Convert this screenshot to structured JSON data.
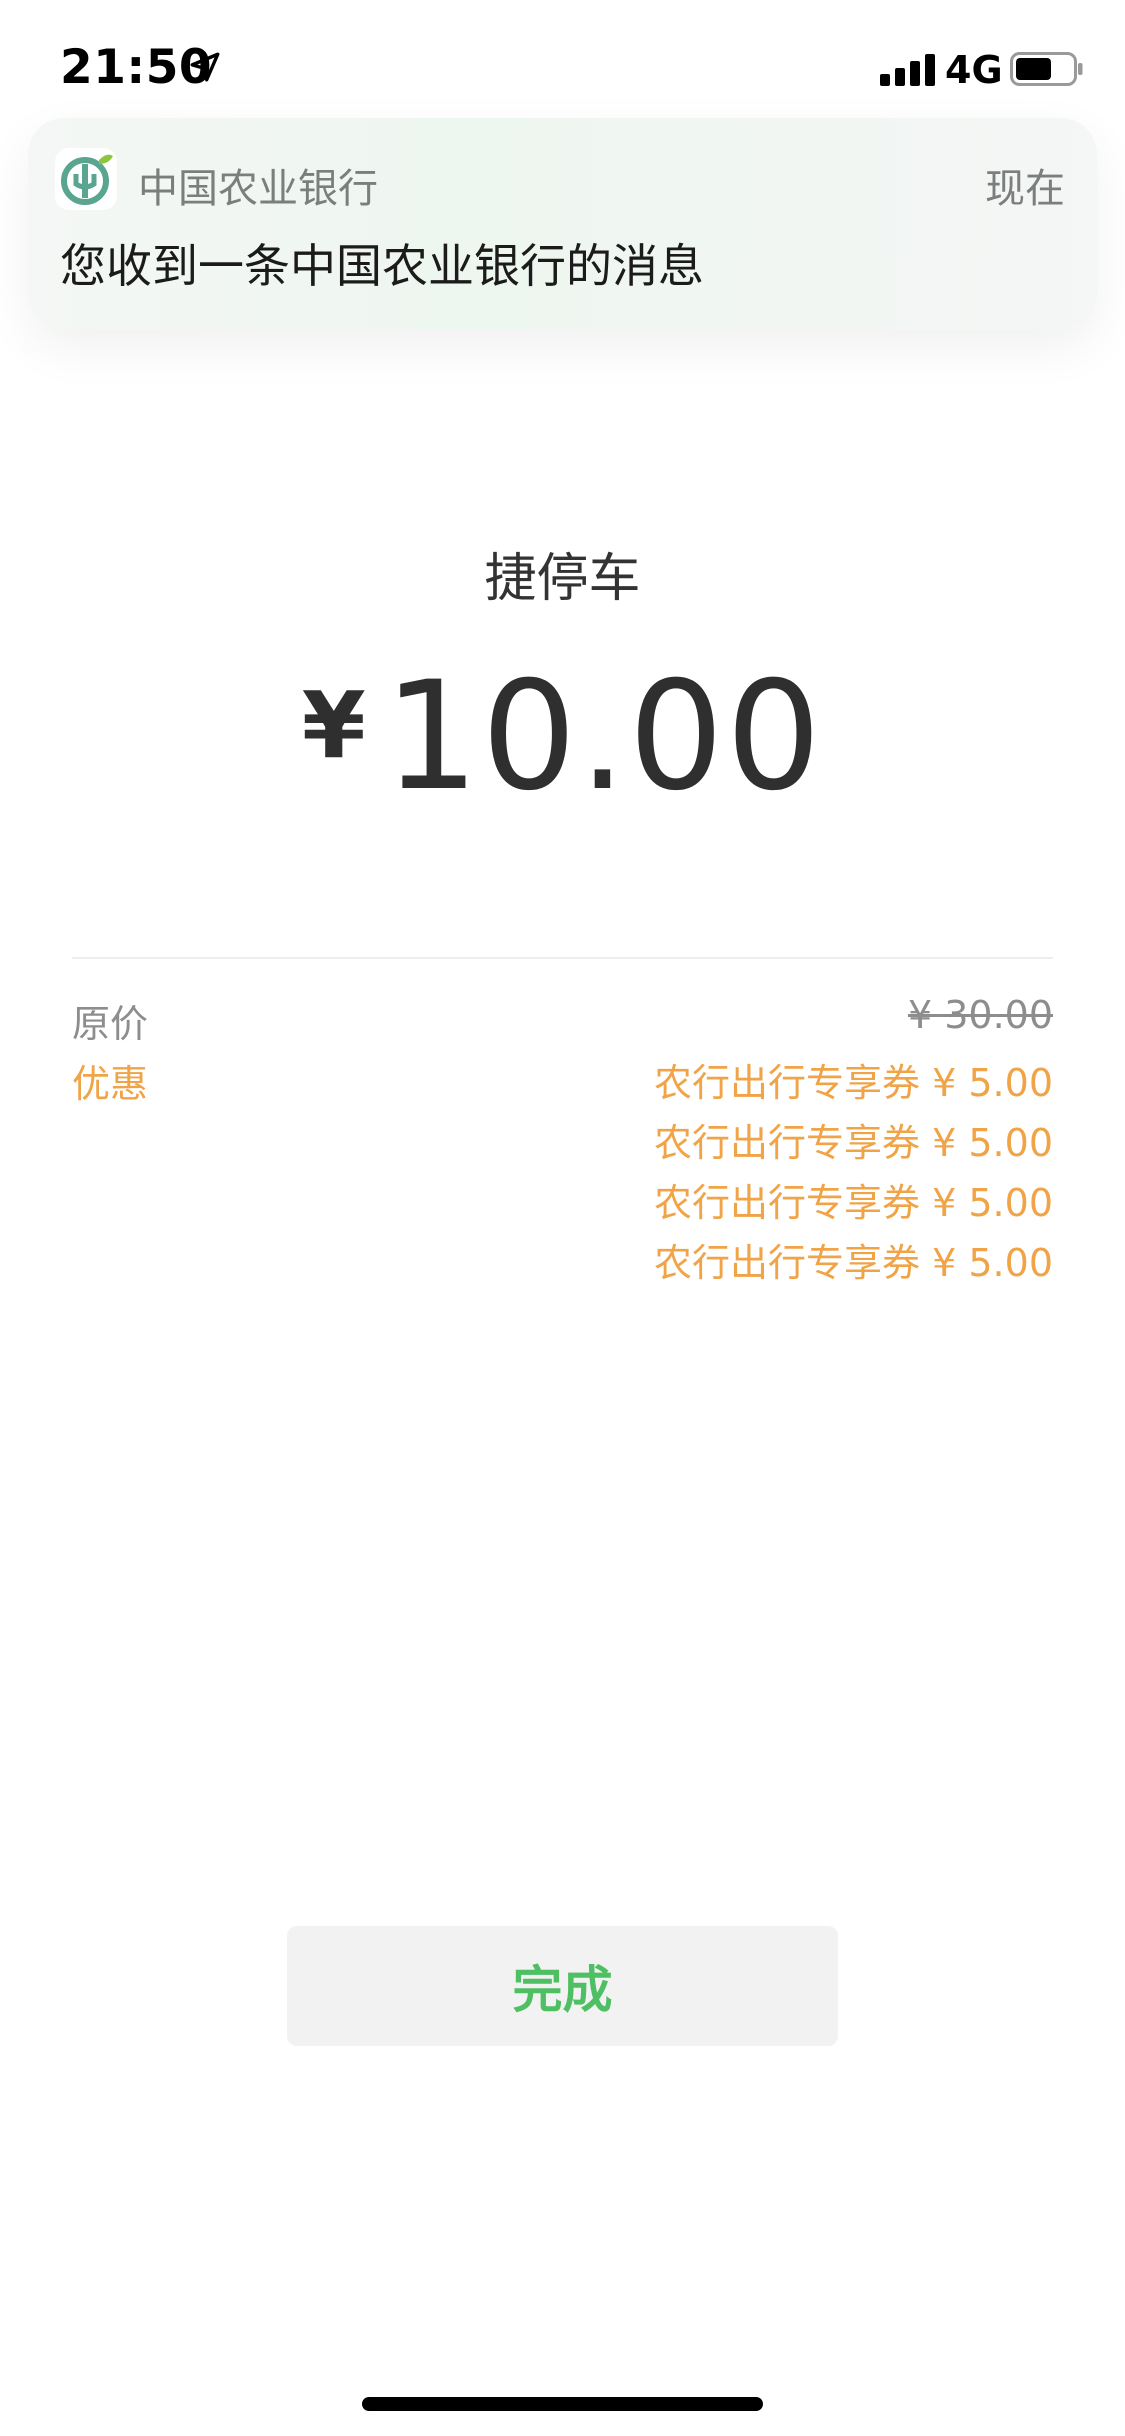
{
  "status_bar": {
    "time": "21:50",
    "network": "4G",
    "icons": [
      "location-arrow-icon",
      "signal-bars-icon",
      "battery-icon"
    ]
  },
  "notification": {
    "app_name": "中国农业银行",
    "time": "现在",
    "message": "您收到一条中国农业银行的消息",
    "icon": "abc-bank-logo-icon"
  },
  "payment": {
    "merchant": "捷停车",
    "currency_symbol": "¥",
    "amount": "10.00"
  },
  "details": {
    "original_label": "原价",
    "original_price": "¥ 30.00",
    "discount_label": "优惠",
    "coupons": [
      "农行出行专享券 ¥ 5.00",
      "农行出行专享券 ¥ 5.00",
      "农行出行专享券 ¥ 5.00",
      "农行出行专享券 ¥ 5.00"
    ]
  },
  "actions": {
    "done_label": "完成"
  },
  "colors": {
    "accent_green": "#4fbf64",
    "discount_orange": "#f0a447",
    "muted_gray": "#8d8d8d"
  }
}
